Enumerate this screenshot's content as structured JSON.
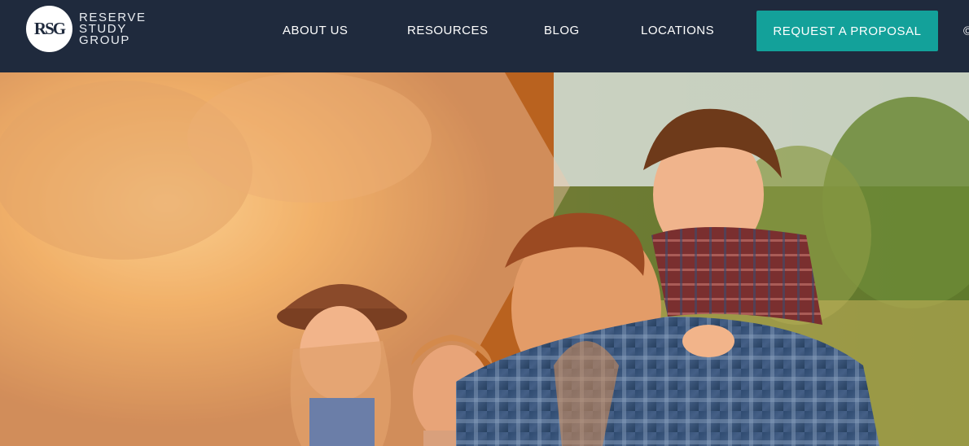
{
  "header": {
    "logo": {
      "monogram": "RSG",
      "wordmark": [
        "RESERVE",
        "STUDY",
        "GROUP"
      ]
    },
    "nav": [
      {
        "label": "ABOUT US"
      },
      {
        "label": "RESOURCES"
      },
      {
        "label": "BLOG"
      },
      {
        "label": "LOCATIONS"
      }
    ],
    "cta_label": "REQUEST A PROPOSAL",
    "edge_glyph": "©"
  },
  "colors": {
    "header_bg": "#1f2a3d",
    "cta_bg": "#13a19a",
    "overlay_peach": "#f4c8ab"
  },
  "hero": {
    "image": "family-outdoors-sunset-photo"
  }
}
